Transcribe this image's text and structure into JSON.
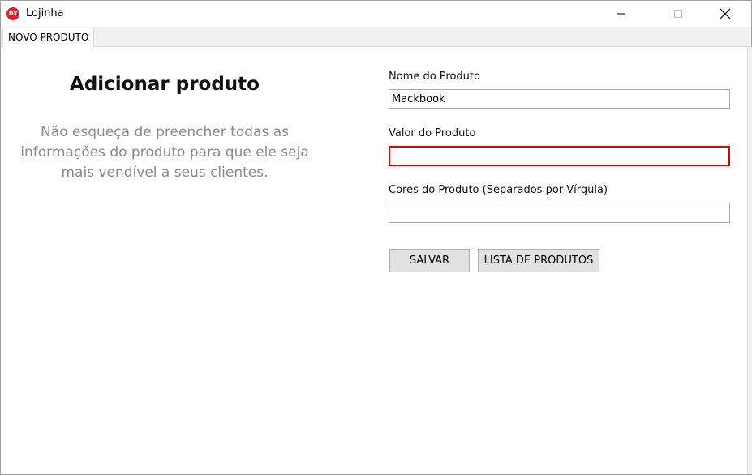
{
  "window": {
    "title": "Lojinha",
    "app_icon_text": "DX"
  },
  "tabs": [
    {
      "label": "NOVO PRODUTO",
      "active": true
    }
  ],
  "left_panel": {
    "heading": "Adicionar produto",
    "description": "Não esqueça de preencher todas as informações do produto para que ele seja mais vendível a seus clientes."
  },
  "form": {
    "name": {
      "label": "Nome do Produto",
      "value": "Mackbook"
    },
    "price": {
      "label": "Valor do Produto",
      "value": "",
      "state": "error"
    },
    "colors": {
      "label": "Cores do Produto (Separados por Vírgula)",
      "value": ""
    },
    "save_label": "SALVAR",
    "list_label": "LISTA DE PRODUTOS"
  },
  "colors": {
    "error_border": "#e00000",
    "app_icon": "#e0212b"
  }
}
